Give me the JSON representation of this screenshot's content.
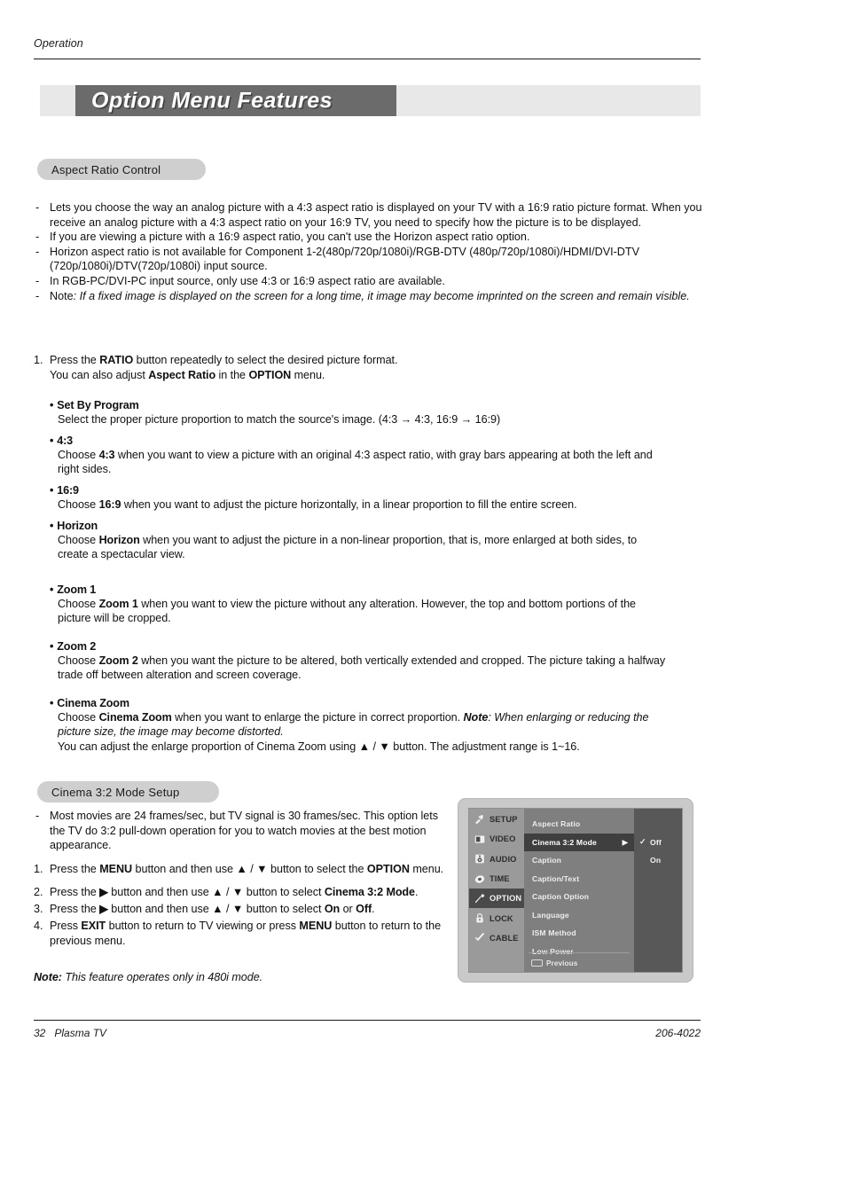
{
  "running_head": "Operation",
  "title_bar": {
    "title": "Option Menu Features"
  },
  "sections": {
    "aspect": {
      "pill_label": "Aspect Ratio Control",
      "notes": [
        {
          "dash": "-",
          "line1": "Lets you choose the way an analog picture with a 4:3 aspect ratio is displayed on your TV with a 16:9 ratio picture format. When you receive an analog picture with a 4:3 aspect ratio on your 16:9 TV, you need to specify how the picture is to be displayed."
        },
        {
          "dash": "-",
          "line1": "If you are viewing a picture with a 16:9 aspect ratio, you can't use the Horizon aspect ratio option."
        },
        {
          "dash": "-",
          "line1": "Horizon aspect ratio is not available for Component 1-2(480p/720p/1080i)/RGB-DTV (480p/720p/1080i)/HDMI/DVI-DTV (720p/1080i)/DTV(720p/1080i) input source."
        },
        {
          "dash": "-",
          "line1": "In RGB-PC/DVI-PC input source, only use 4:3 or 16:9 aspect ratio are available."
        }
      ],
      "note_label": "Note",
      "note_body": ": If a fixed image is displayed on the screen for a long time, it image may become imprinted on the screen and remain visible.",
      "step1_num": "1.",
      "step1_a_pre": "Press the ",
      "step1_a_bold": "RATIO",
      "step1_a_post": " button repeatedly to select the desired picture format.",
      "step1_b_pre": "You can also adjust ",
      "step1_b_bold1": "Aspect Ratio",
      "step1_b_mid": " in the ",
      "step1_b_bold2": "OPTION",
      "step1_b_post": " menu.",
      "definitions": [
        {
          "term": "Set By Program",
          "body": "Select the proper picture proportion to match the source's image.  (4:3 → 4:3, 16:9 → 16:9)"
        },
        {
          "term": "4:3",
          "body_pre": "Choose ",
          "body_bold": "4:3",
          "body_post": " when you want to view a picture with an original 4:3 aspect ratio, with gray bars appearing at both the left and right sides."
        },
        {
          "term": "16:9",
          "body_pre": "Choose ",
          "body_bold": "16:9",
          "body_post": " when you want to adjust the picture horizontally, in a linear proportion to fill the entire screen."
        },
        {
          "term": "Horizon",
          "body_pre": "Choose ",
          "body_bold": "Horizon",
          "body_post": " when you want to adjust the picture in a non-linear proportion, that is, more enlarged at both sides, to create a spectacular view."
        },
        {
          "term": "Zoom 1",
          "body_pre": "Choose ",
          "body_bold": "Zoom 1",
          "body_post": " when you want to view the picture without any alteration. However, the top and bottom portions of the picture will be cropped."
        },
        {
          "term": "Zoom 2",
          "body_pre": "Choose ",
          "body_bold": "Zoom 2",
          "body_post": " when you want the picture to be altered, both vertically extended and cropped. The picture taking a halfway trade off between alteration and screen coverage."
        },
        {
          "term": "Cinema Zoom",
          "body_pre": "Choose ",
          "body_bold": "Cinema Zoom",
          "body_post": " when you want to enlarge the picture in correct proportion. ",
          "body_note_label": "Note",
          "body_note_italic": ": When enlarging or reducing the picture size, the image may become distorted.",
          "body_extra_pre": "You can adjust the enlarge proportion of Cinema Zoom using ",
          "body_extra_up": "▲",
          "body_extra_slash": " / ",
          "body_extra_down": "▼",
          "body_extra_post": " button. The adjustment range is 1~16."
        }
      ]
    },
    "cinema": {
      "pill_label": "Cinema 3:2 Mode Setup",
      "intro_dash": "-",
      "intro": "Most movies are 24 frames/sec, but TV signal is 30 frames/sec. This option lets the TV do 3:2 pull-down operation for you to watch movies at the best motion appearance.",
      "steps": [
        {
          "num": "1.",
          "pre": "Press the ",
          "b1": "MENU",
          "mid1": " button and then use ",
          "up": "▲",
          "slash": " / ",
          "down": "▼",
          "mid2": " button to select the ",
          "b2": "OPTION",
          "post": " menu."
        },
        {
          "num": "2.",
          "pre": "Press the ",
          "b1": "▶",
          "mid1": " button and then use ",
          "up": "▲",
          "slash": " / ",
          "down": "▼",
          "mid2": " button to select ",
          "b2": "Cinema 3:2 Mode",
          "post": "."
        },
        {
          "num": "3.",
          "pre": "Press the ",
          "b1": "▶",
          "mid1": " button and then use ",
          "up": "▲",
          "slash": " / ",
          "down": "▼",
          "mid2": " button to select ",
          "b2": "On",
          "mid3": " or ",
          "b3": "Off",
          "post": "."
        },
        {
          "num": "4.",
          "pre": "Press ",
          "b1": "EXIT",
          "mid1": " button to return to TV viewing or press ",
          "b2": "MENU",
          "post": " button to return to the previous menu."
        }
      ],
      "final_note_label": "Note:",
      "final_note_body": " This feature operates only in 480i mode."
    }
  },
  "osd": {
    "side_items": [
      {
        "label": "SETUP",
        "icon": "satellite-icon",
        "selected": false
      },
      {
        "label": "VIDEO",
        "icon": "monitor-icon",
        "selected": false
      },
      {
        "label": "AUDIO",
        "icon": "speaker-icon",
        "selected": false
      },
      {
        "label": "TIME",
        "icon": "clock-icon",
        "selected": false
      },
      {
        "label": "OPTION",
        "icon": "wrench-icon",
        "selected": true
      },
      {
        "label": "LOCK",
        "icon": "padlock-icon",
        "selected": false
      },
      {
        "label": "CABLE",
        "icon": "checkmark-icon",
        "selected": false
      }
    ],
    "menu_items": [
      {
        "label": "Aspect Ratio",
        "selected": false,
        "arrow": ""
      },
      {
        "label": "Cinema 3:2 Mode",
        "selected": true,
        "arrow": "▶"
      },
      {
        "label": "Caption",
        "selected": false,
        "arrow": ""
      },
      {
        "label": "Caption/Text",
        "selected": false,
        "arrow": ""
      },
      {
        "label": "Caption Option",
        "selected": false,
        "arrow": ""
      },
      {
        "label": "Language",
        "selected": false,
        "arrow": ""
      },
      {
        "label": "ISM Method",
        "selected": false,
        "arrow": ""
      },
      {
        "label": "Low Power",
        "selected": false,
        "arrow": ""
      }
    ],
    "previous_label": "Previous",
    "options": [
      {
        "label": "Off",
        "checked": true,
        "check": "✓"
      },
      {
        "label": "On",
        "checked": false,
        "check": "✓"
      }
    ]
  },
  "footer": {
    "page_number": "32",
    "product": "Plasma TV",
    "doc_code": "206-4022"
  },
  "colors": {
    "title_bar_light": "#e8e8e8",
    "title_bar_dark": "#6b6b6b",
    "pill_bg": "#cfcfcf",
    "osd_sidebar": "#9a9a9a",
    "osd_menu": "#7f7f7f",
    "osd_right": "#585858",
    "osd_selected": "#3f3f3f"
  }
}
